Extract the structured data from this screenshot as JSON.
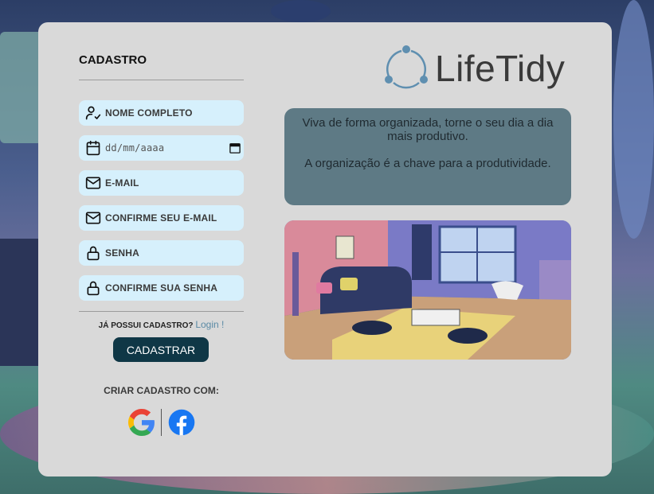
{
  "form": {
    "title": "CADASTRO",
    "fields": [
      {
        "label": "NOME COMPLETO",
        "icon": "user-check-icon"
      },
      {
        "placeholder": "dd/mm/aaaa",
        "icon": "calendar-icon"
      },
      {
        "label": "E-MAIL",
        "icon": "mail-icon"
      },
      {
        "label": "CONFIRME SEU E-MAIL",
        "icon": "mail-icon"
      },
      {
        "label": "SENHA",
        "icon": "lock-icon"
      },
      {
        "label": "CONFIRME SUA SENHA",
        "icon": "lock-icon"
      }
    ],
    "login_prompt": "JÁ POSSUI CADASTRO?",
    "login_link": "Login !",
    "submit_label": "CADASTRAR",
    "social_title": "CRIAR CADASTRO COM:",
    "social": [
      "google-icon",
      "facebook-icon"
    ]
  },
  "brand": {
    "name": "LifeTidy",
    "color": "#5f8fb0"
  },
  "quote": {
    "line1": "Viva de forma organizada, torne o seu dia a dia mais produtivo.",
    "line2": "A organização é a chave para a produtividade."
  },
  "colors": {
    "panel": "#d9d9d9",
    "field": "#d6f0fc",
    "button": "#0f3746",
    "quote_box": "#5e7a85"
  }
}
